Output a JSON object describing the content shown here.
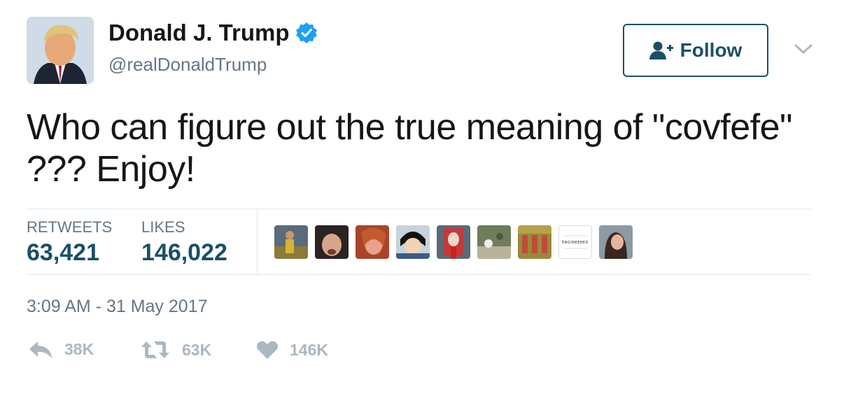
{
  "author": {
    "name": "Donald J. Trump",
    "handle": "@realDonaldTrump",
    "verified": true
  },
  "follow_button": {
    "label": "Follow"
  },
  "tweet": {
    "lines": [
      "Who can figure out the true meaning of \"covfefe\"",
      "???  Enjoy!"
    ]
  },
  "stats": {
    "retweets_label": "RETWEETS",
    "retweets_value": "63,421",
    "likes_label": "LIKES",
    "likes_value": "146,022"
  },
  "likers": [
    {
      "name": "liker-avatar-1"
    },
    {
      "name": "liker-avatar-2"
    },
    {
      "name": "liker-avatar-3"
    },
    {
      "name": "liker-avatar-4"
    },
    {
      "name": "liker-avatar-5"
    },
    {
      "name": "liker-avatar-6"
    },
    {
      "name": "liker-avatar-7"
    },
    {
      "name": "liker-avatar-8",
      "text": "ENGINEERED"
    },
    {
      "name": "liker-avatar-9"
    }
  ],
  "timestamp": "3:09 AM - 31 May 2017",
  "actions": {
    "reply_count": "38K",
    "retweet_count": "63K",
    "like_count": "146K"
  },
  "colors": {
    "accent": "#1b4f66",
    "verified": "#1da1f2",
    "muted": "#657786",
    "icon": "#aab8c2"
  }
}
